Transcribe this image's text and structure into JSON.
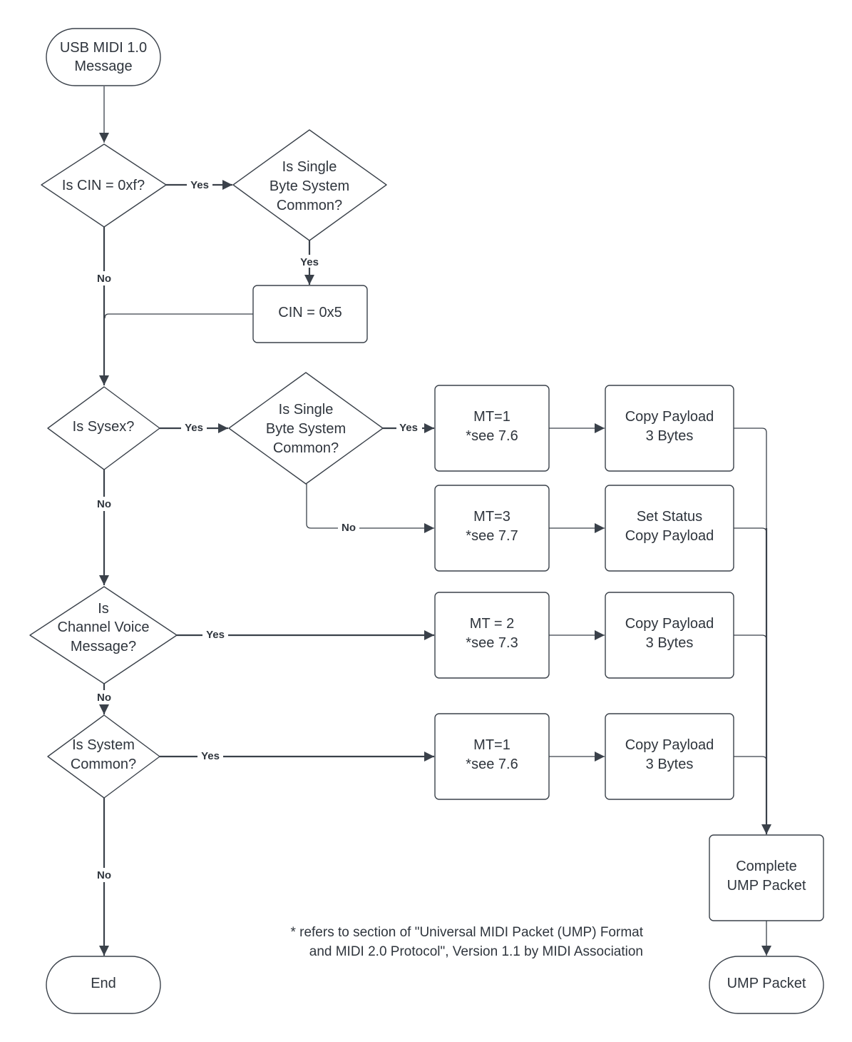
{
  "diagram": {
    "type": "flowchart",
    "nodes": {
      "start": {
        "kind": "terminator",
        "lines": [
          "USB MIDI 1.0",
          "Message"
        ]
      },
      "is_cin_0xf": {
        "kind": "decision",
        "lines": [
          "Is CIN = 0xf?"
        ]
      },
      "is_single_byte_1": {
        "kind": "decision",
        "lines": [
          "Is Single",
          "Byte System",
          "Common?"
        ]
      },
      "cin_0x5": {
        "kind": "process",
        "lines": [
          "CIN = 0x5"
        ]
      },
      "is_sysex": {
        "kind": "decision",
        "lines": [
          "Is Sysex?"
        ]
      },
      "is_single_byte_2": {
        "kind": "decision",
        "lines": [
          "Is Single",
          "Byte System",
          "Common?"
        ]
      },
      "mt1_a": {
        "kind": "process",
        "lines": [
          "MT=1",
          "*see 7.6"
        ]
      },
      "copy_a": {
        "kind": "process",
        "lines": [
          "Copy Payload",
          "3 Bytes"
        ]
      },
      "mt3": {
        "kind": "process",
        "lines": [
          "MT=3",
          "*see 7.7"
        ]
      },
      "set_status": {
        "kind": "process",
        "lines": [
          "Set Status",
          "Copy Payload"
        ]
      },
      "is_channel_voice": {
        "kind": "decision",
        "lines": [
          "Is",
          "Channel Voice",
          "Message?"
        ]
      },
      "mt2": {
        "kind": "process",
        "lines": [
          "MT = 2",
          "*see 7.3"
        ]
      },
      "copy_c": {
        "kind": "process",
        "lines": [
          "Copy Payload",
          "3 Bytes"
        ]
      },
      "is_system_common": {
        "kind": "decision",
        "lines": [
          "Is System",
          "Common?"
        ]
      },
      "mt1_b": {
        "kind": "process",
        "lines": [
          "MT=1",
          "*see 7.6"
        ]
      },
      "copy_d": {
        "kind": "process",
        "lines": [
          "Copy Payload",
          "3 Bytes"
        ]
      },
      "complete_ump": {
        "kind": "process",
        "lines": [
          "Complete",
          "UMP Packet"
        ]
      },
      "end": {
        "kind": "terminator",
        "lines": [
          "End"
        ]
      },
      "ump_packet": {
        "kind": "terminator",
        "lines": [
          "UMP Packet"
        ]
      }
    },
    "edges": [
      {
        "from": "start",
        "to": "is_cin_0xf",
        "label": ""
      },
      {
        "from": "is_cin_0xf",
        "to": "is_single_byte_1",
        "label": "Yes"
      },
      {
        "from": "is_cin_0xf",
        "to": "is_sysex",
        "label": "No"
      },
      {
        "from": "is_single_byte_1",
        "to": "cin_0x5",
        "label": "Yes"
      },
      {
        "from": "cin_0x5",
        "to": "is_sysex",
        "label": ""
      },
      {
        "from": "is_sysex",
        "to": "is_single_byte_2",
        "label": "Yes"
      },
      {
        "from": "is_sysex",
        "to": "is_channel_voice",
        "label": "No"
      },
      {
        "from": "is_single_byte_2",
        "to": "mt1_a",
        "label": "Yes"
      },
      {
        "from": "is_single_byte_2",
        "to": "mt3",
        "label": "No"
      },
      {
        "from": "mt1_a",
        "to": "copy_a",
        "label": ""
      },
      {
        "from": "mt3",
        "to": "set_status",
        "label": ""
      },
      {
        "from": "is_channel_voice",
        "to": "mt2",
        "label": "Yes"
      },
      {
        "from": "is_channel_voice",
        "to": "is_system_common",
        "label": "No"
      },
      {
        "from": "mt2",
        "to": "copy_c",
        "label": ""
      },
      {
        "from": "is_system_common",
        "to": "mt1_b",
        "label": "Yes"
      },
      {
        "from": "is_system_common",
        "to": "end",
        "label": "No"
      },
      {
        "from": "mt1_b",
        "to": "copy_d",
        "label": ""
      },
      {
        "from": "copy_a",
        "to": "complete_ump",
        "label": ""
      },
      {
        "from": "set_status",
        "to": "complete_ump",
        "label": ""
      },
      {
        "from": "copy_c",
        "to": "complete_ump",
        "label": ""
      },
      {
        "from": "copy_d",
        "to": "complete_ump",
        "label": ""
      },
      {
        "from": "complete_ump",
        "to": "ump_packet",
        "label": ""
      }
    ],
    "labels": {
      "yes": "Yes",
      "no": "No"
    },
    "footnote": [
      "* refers to section of \"Universal MIDI Packet (UMP) Format",
      "and MIDI 2.0 Protocol\", Version 1.1 by MIDI Association"
    ]
  }
}
